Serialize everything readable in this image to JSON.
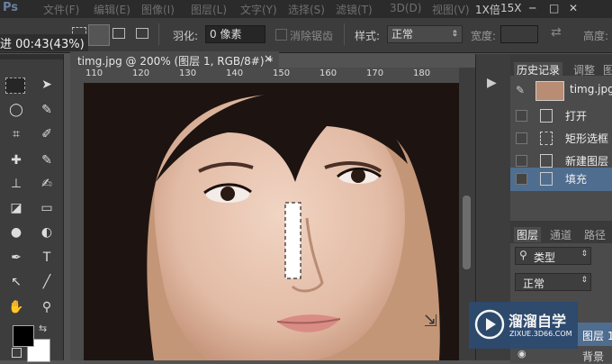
{
  "menubar": {
    "logo": "Ps",
    "items": [
      "文件(F)",
      "编辑(E)",
      "图像(I)",
      "图层(L)",
      "文字(Y)",
      "选择(S)",
      "滤镜(T)",
      "3D(D)",
      "视图(V)"
    ],
    "window_state": "1X倍",
    "zoom": "15X",
    "window_controls": [
      "─",
      "□",
      "✕"
    ]
  },
  "options": {
    "feather_label": "羽化:",
    "feather_value": "0 像素",
    "antialias_label": "消除锯齿",
    "style_label": "样式:",
    "style_value": "正常",
    "width_label": "宽度:",
    "height_label": "高度:"
  },
  "progress_text": "进    00:43(43%)",
  "document": {
    "tab_title": "timg.jpg @ 200% (图层 1, RGB/8#) *",
    "close_icon": "close-icon",
    "ruler_ticks": [
      "110",
      "120",
      "130",
      "140",
      "150",
      "160",
      "170",
      "180"
    ]
  },
  "history": {
    "tabs": [
      "历史记录",
      "调整",
      "图"
    ],
    "snapshot_label": "timg.jpg",
    "items": [
      {
        "label": "打开",
        "icon": "document-icon",
        "selected": false
      },
      {
        "label": "矩形选框",
        "icon": "marquee-icon",
        "selected": false
      },
      {
        "label": "新建图层",
        "icon": "document-icon",
        "selected": false
      },
      {
        "label": "填充",
        "icon": "document-icon",
        "selected": true
      }
    ]
  },
  "layers": {
    "tabs": [
      "图层",
      "通道",
      "路径"
    ],
    "filter_label": "类型",
    "blend_mode": "正常",
    "rows": [
      {
        "label": "图层 1"
      },
      {
        "label": "背景"
      }
    ]
  },
  "watermark": {
    "brand": "溜溜自学",
    "url": "ZIXUE.3D66.COM"
  },
  "colors": {
    "accent_selected": "#4f6d8f",
    "canvas_bg": "#535353",
    "panel": "#4b4b4b"
  }
}
